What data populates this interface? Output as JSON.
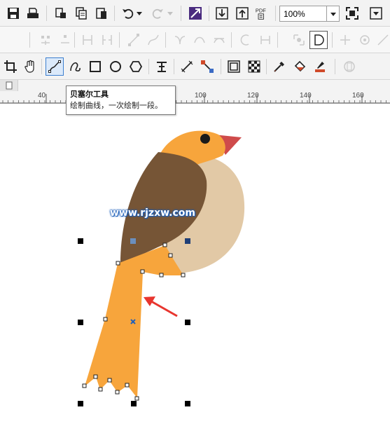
{
  "toolbar_standard": {
    "zoom_value": "100%",
    "pdf_label": "PDF"
  },
  "tooltip": {
    "title": "贝塞尔工具",
    "description": "绘制曲线，一次绘制一段。"
  },
  "ruler": {
    "ticks": [
      "40",
      "100",
      "120",
      "140",
      "160"
    ]
  },
  "watermark": "www.rjzxw.com",
  "colors": {
    "bird_head": "#f7a53c",
    "bird_wing": "#765536",
    "bird_belly": "#e2c9a6",
    "bird_beak": "#cf4b4b",
    "bird_tail": "#f7a53c",
    "arrow": "#e8352e",
    "active_tool": "#3c7fd0"
  },
  "icons": {
    "active_tool": "bezier-tool-icon"
  }
}
